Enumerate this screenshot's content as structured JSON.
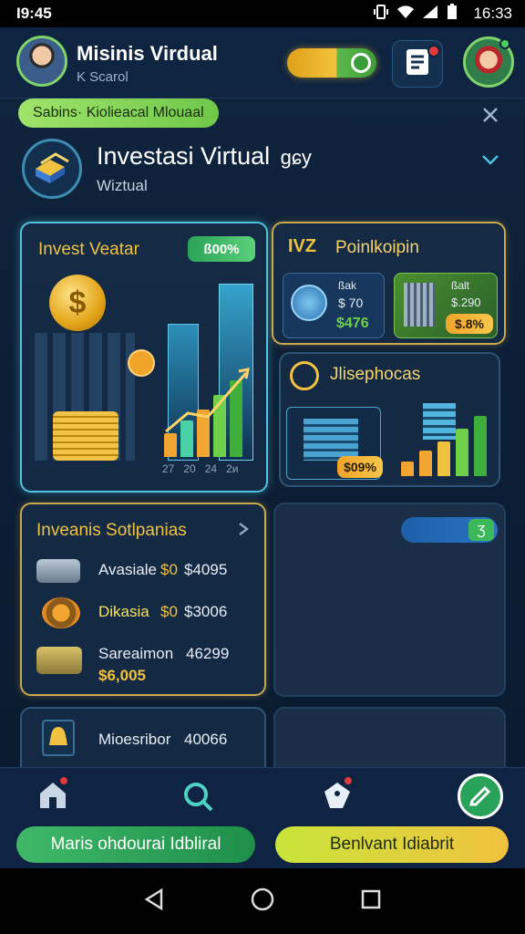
{
  "status_bar": {
    "time": "I9:45",
    "clock": "16:33"
  },
  "header": {
    "title": "Misinis Virdual",
    "subtitle": "K Scarol",
    "notification_dot": "!",
    "avatar_dot": "•"
  },
  "chip": {
    "label": "Sabins·  Kiolieacal Mlouaal"
  },
  "investment": {
    "title": "Investasi  Virtual",
    "title_suffix": "ɡɕу",
    "subtitle": "Wiztual"
  },
  "card_invest": {
    "title": "Invest Veatar",
    "badge": "ß00%",
    "axis": [
      "27",
      "20",
      "24",
      "2и"
    ]
  },
  "card_point": {
    "prefix": "IVZ",
    "title": "Poinlkoipin",
    "mini1": {
      "label": "ßak",
      "value": "$ 70",
      "amount": "$476"
    },
    "mini2": {
      "label": "ßalt",
      "value": "$.290",
      "badge": "$.8%"
    }
  },
  "card_jila": {
    "title": "Jlisephocas",
    "badge": "$09%"
  },
  "list_card": {
    "title": "Inveanis Sotlpanias",
    "items": [
      {
        "name": "Avasiale",
        "price": "$0",
        "amount": "$4095"
      },
      {
        "name": "Dikasia",
        "price": "$0",
        "amount": "$3006"
      },
      {
        "name": "Sareaimon",
        "price": "",
        "amount": "46299",
        "sub": "$6,005"
      }
    ],
    "extra": {
      "name": "Mioesribor",
      "amount": "40066"
    }
  },
  "side_toggle": {
    "label": "Ʒ"
  },
  "bottom_buttons": {
    "left": "Maris ohdourai Idbliral",
    "right": "Benlvant Idiabrit"
  },
  "colors": {
    "accent_green": "#5bd17a",
    "accent_gold": "#f1c23f",
    "accent_blue": "#4fc3e0",
    "background": "#0b1a2e"
  }
}
